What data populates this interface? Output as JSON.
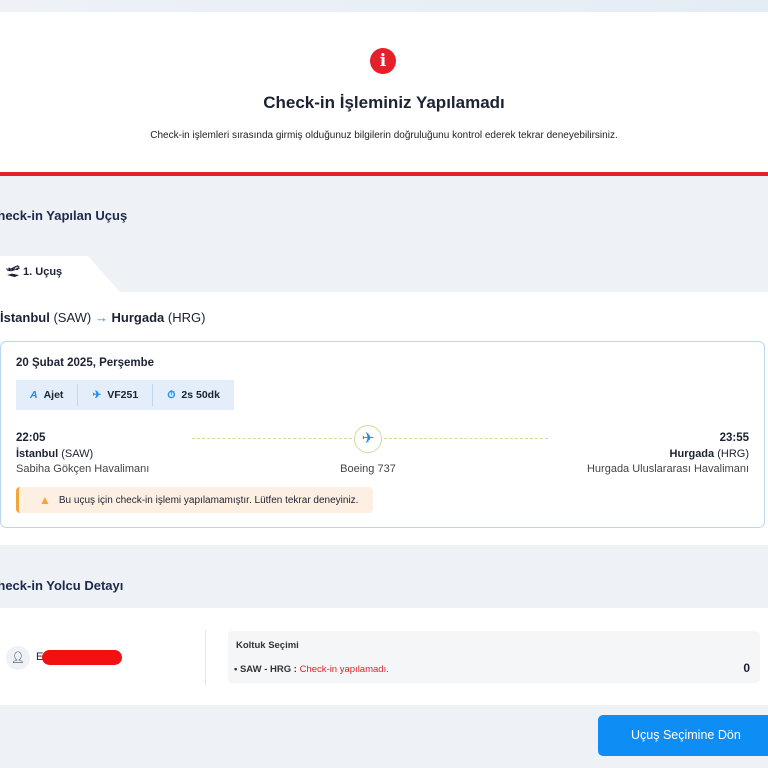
{
  "hero": {
    "title": "Check-in İşleminiz Yapılamadı",
    "subtitle": "Check-in işlemleri sırasında girmiş olduğunuz bilgilerin doğruluğunu kontrol ederek tekrar deneyebilirsiniz."
  },
  "flight_section": {
    "title": "Check-in Yapılan Uçuş",
    "tab": "1. Uçuş",
    "route": {
      "from_city": "İstanbul",
      "from_code": "(SAW)",
      "to_city": "Hurgada",
      "to_code": "(HRG)"
    },
    "date": "20 Şubat 2025, Perşembe",
    "chips": {
      "airline": "Ajet",
      "flight_no": "VF251",
      "duration": "2s 50dk"
    },
    "departure": {
      "time": "22:05",
      "city": "İstanbul",
      "code": "(SAW)",
      "airport": "Sabiha Gökçen Havalimanı"
    },
    "arrival": {
      "time": "23:55",
      "city": "Hurgada",
      "code": "(HRG)",
      "airport": "Hurgada Uluslararası Havalimanı"
    },
    "aircraft": "Boeing 737",
    "warning": "Bu uçuş için check-in işlemi yapılamamıştır. Lütfen tekrar deneyiniz."
  },
  "passenger_section": {
    "title": "Check-in Yolcu Detayı",
    "passenger_initial": "E",
    "seat_title": "Koltuk Seçimi",
    "seat_route": "• SAW - HRG :",
    "seat_status": "Check-in yapılamadı.",
    "seat_price": "0"
  },
  "actions": {
    "back": "Uçuş Seçimine Dön"
  },
  "colors": {
    "accent": "#0e8ef5",
    "error": "#e5202a",
    "warning": "#f1a53a"
  }
}
